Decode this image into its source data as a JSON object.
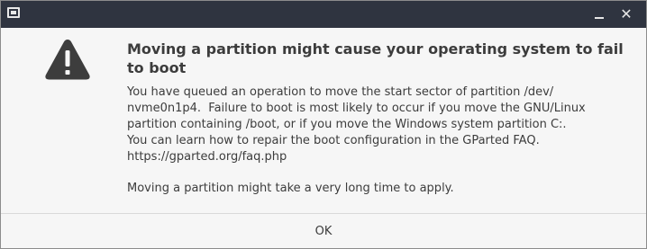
{
  "titlebar": {
    "app_icon": "window-icon",
    "minimize_icon": "minimize-icon",
    "close_symbol": "✕",
    "background": "#2f3440"
  },
  "dialog": {
    "icon": "warning-icon",
    "heading": "Moving a partition might cause your operating system to fail to boot",
    "body_lines": [
      "You have queued an operation to move the start sector of partition /dev/",
      "nvme0n1p4.  Failure to boot is most likely to occur if you move the GNU/Linux",
      "partition containing /boot, or if you move the Windows system partition C:.",
      "You can learn how to repair the boot configuration in the GParted FAQ.",
      "https://gparted.org/faq.php"
    ],
    "secondary_text": "Moving a partition might take a very long time to apply."
  },
  "buttons": {
    "ok_label": "OK"
  },
  "colors": {
    "text": "#3c3c3c",
    "background": "#f6f6f6",
    "icon": "#3d3d3d"
  }
}
